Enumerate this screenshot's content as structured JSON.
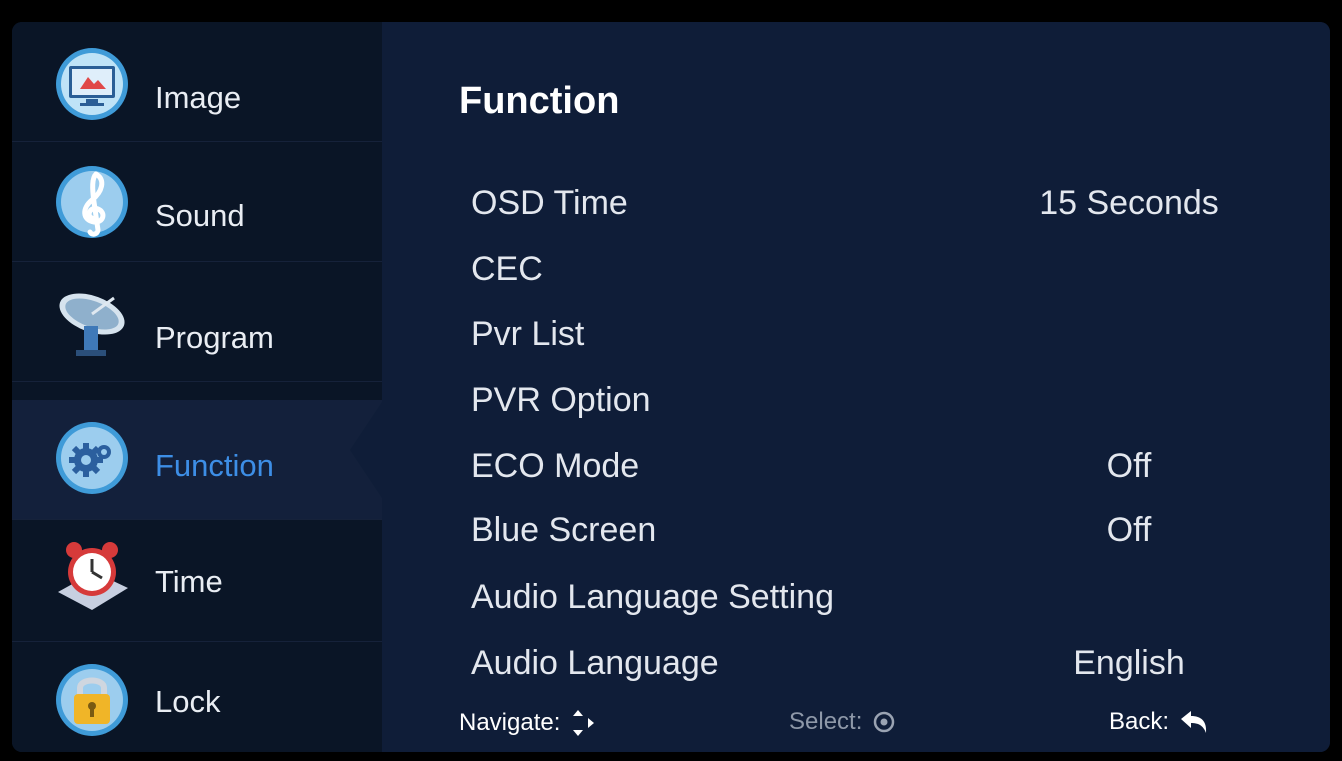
{
  "sidebar": {
    "items": [
      {
        "label": "Image",
        "icon": "monitor-icon"
      },
      {
        "label": "Sound",
        "icon": "treble-clef-icon"
      },
      {
        "label": "Program",
        "icon": "satellite-dish-icon"
      },
      {
        "label": "Function",
        "icon": "gear-icon",
        "selected": true
      },
      {
        "label": "Time",
        "icon": "alarm-clock-icon"
      },
      {
        "label": "Lock",
        "icon": "padlock-icon"
      }
    ]
  },
  "main": {
    "title": "Function",
    "rows": [
      {
        "label": "OSD Time",
        "value": "15 Seconds"
      },
      {
        "label": "CEC",
        "value": ""
      },
      {
        "label": "Pvr List",
        "value": ""
      },
      {
        "label": "PVR Option",
        "value": ""
      },
      {
        "label": "ECO Mode",
        "value": "Off"
      },
      {
        "label": "Blue Screen",
        "value": "Off"
      },
      {
        "label": "Audio Language Setting",
        "value": ""
      },
      {
        "label": "Audio Language",
        "value": "English"
      }
    ]
  },
  "footer": {
    "navigate_label": "Navigate:",
    "navigate_icon": "navigate-arrows-icon",
    "select_label": "Select:",
    "select_icon": "select-circle-icon",
    "back_label": "Back:",
    "back_icon": "back-arrow-icon"
  },
  "colors": {
    "panel_bg": "#0f1d38",
    "sidebar_bg": "#0a1526",
    "active_label": "#3d8ee6",
    "text": "#e3e7ee"
  }
}
